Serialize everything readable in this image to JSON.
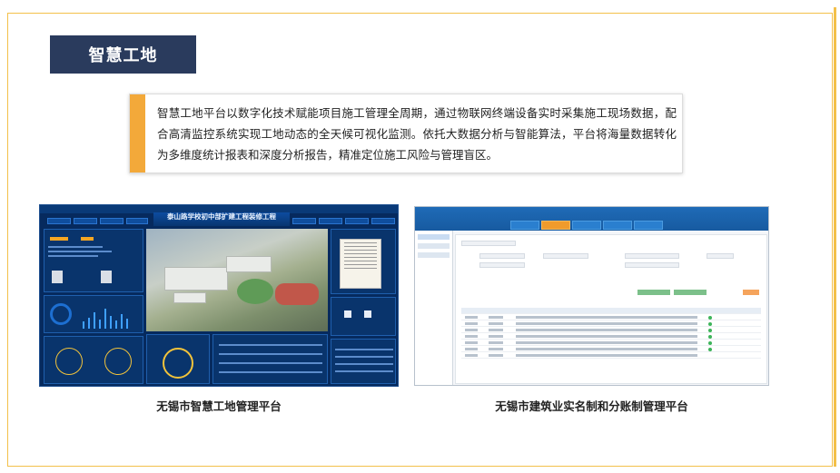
{
  "slide": {
    "title": "智慧工地",
    "description": "智慧工地平台以数字化技术赋能项目施工管理全周期，通过物联网终端设备实时采集施工现场数据，配合高清监控系统实现工地动态的全天候可视化监测。依托大数据分析与智能算法，平台将海量数据转化为多维度统计报表和深度分析报告，精准定位施工风险与管理盲区。",
    "accent_color": "#f3a93a",
    "title_bg_color": "#2a3b5d"
  },
  "screenshots": [
    {
      "caption": "无锡市智慧工地管理平台",
      "dashboard_title": "泰山路学校初中部扩建工程装修工程"
    },
    {
      "caption": "无锡市建筑业实名制和分账制管理平台"
    }
  ]
}
